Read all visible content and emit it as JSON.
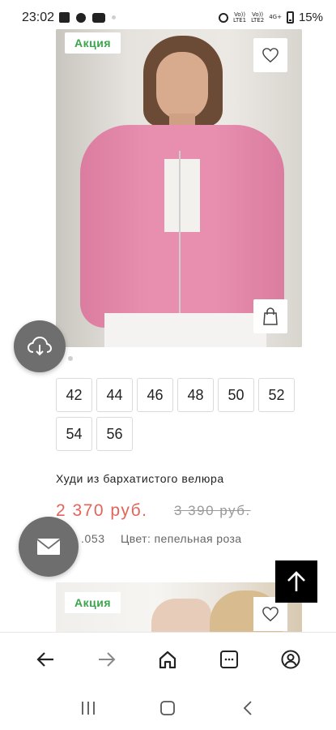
{
  "status_bar": {
    "time": "23:02",
    "sim1": "Vo))\nLTE1",
    "sim2": "Vo))\nLTE2",
    "network": "4G+",
    "battery": "15%"
  },
  "product": {
    "badge": "Акция",
    "title": "Худи из бархатистого велюра",
    "price_new": "2 370 руб.",
    "price_old": "3 390 руб.",
    "article": ".053",
    "color": "Цвет: пепельная роза",
    "sizes": [
      "42",
      "44",
      "46",
      "48",
      "50",
      "52",
      "54",
      "56"
    ]
  },
  "product2": {
    "badge": "Акция"
  },
  "icons": {
    "fav": "heart-icon",
    "cart": "shopping-bag-icon",
    "cloud": "cloud-download-icon",
    "mail": "mail-icon",
    "scroll_top": "arrow-up-icon"
  },
  "colors": {
    "sale_green": "#3aa64a",
    "price_red": "#e4635b",
    "old_price_gray": "#9a9a9a",
    "fab_gray": "#6e6e6e"
  }
}
